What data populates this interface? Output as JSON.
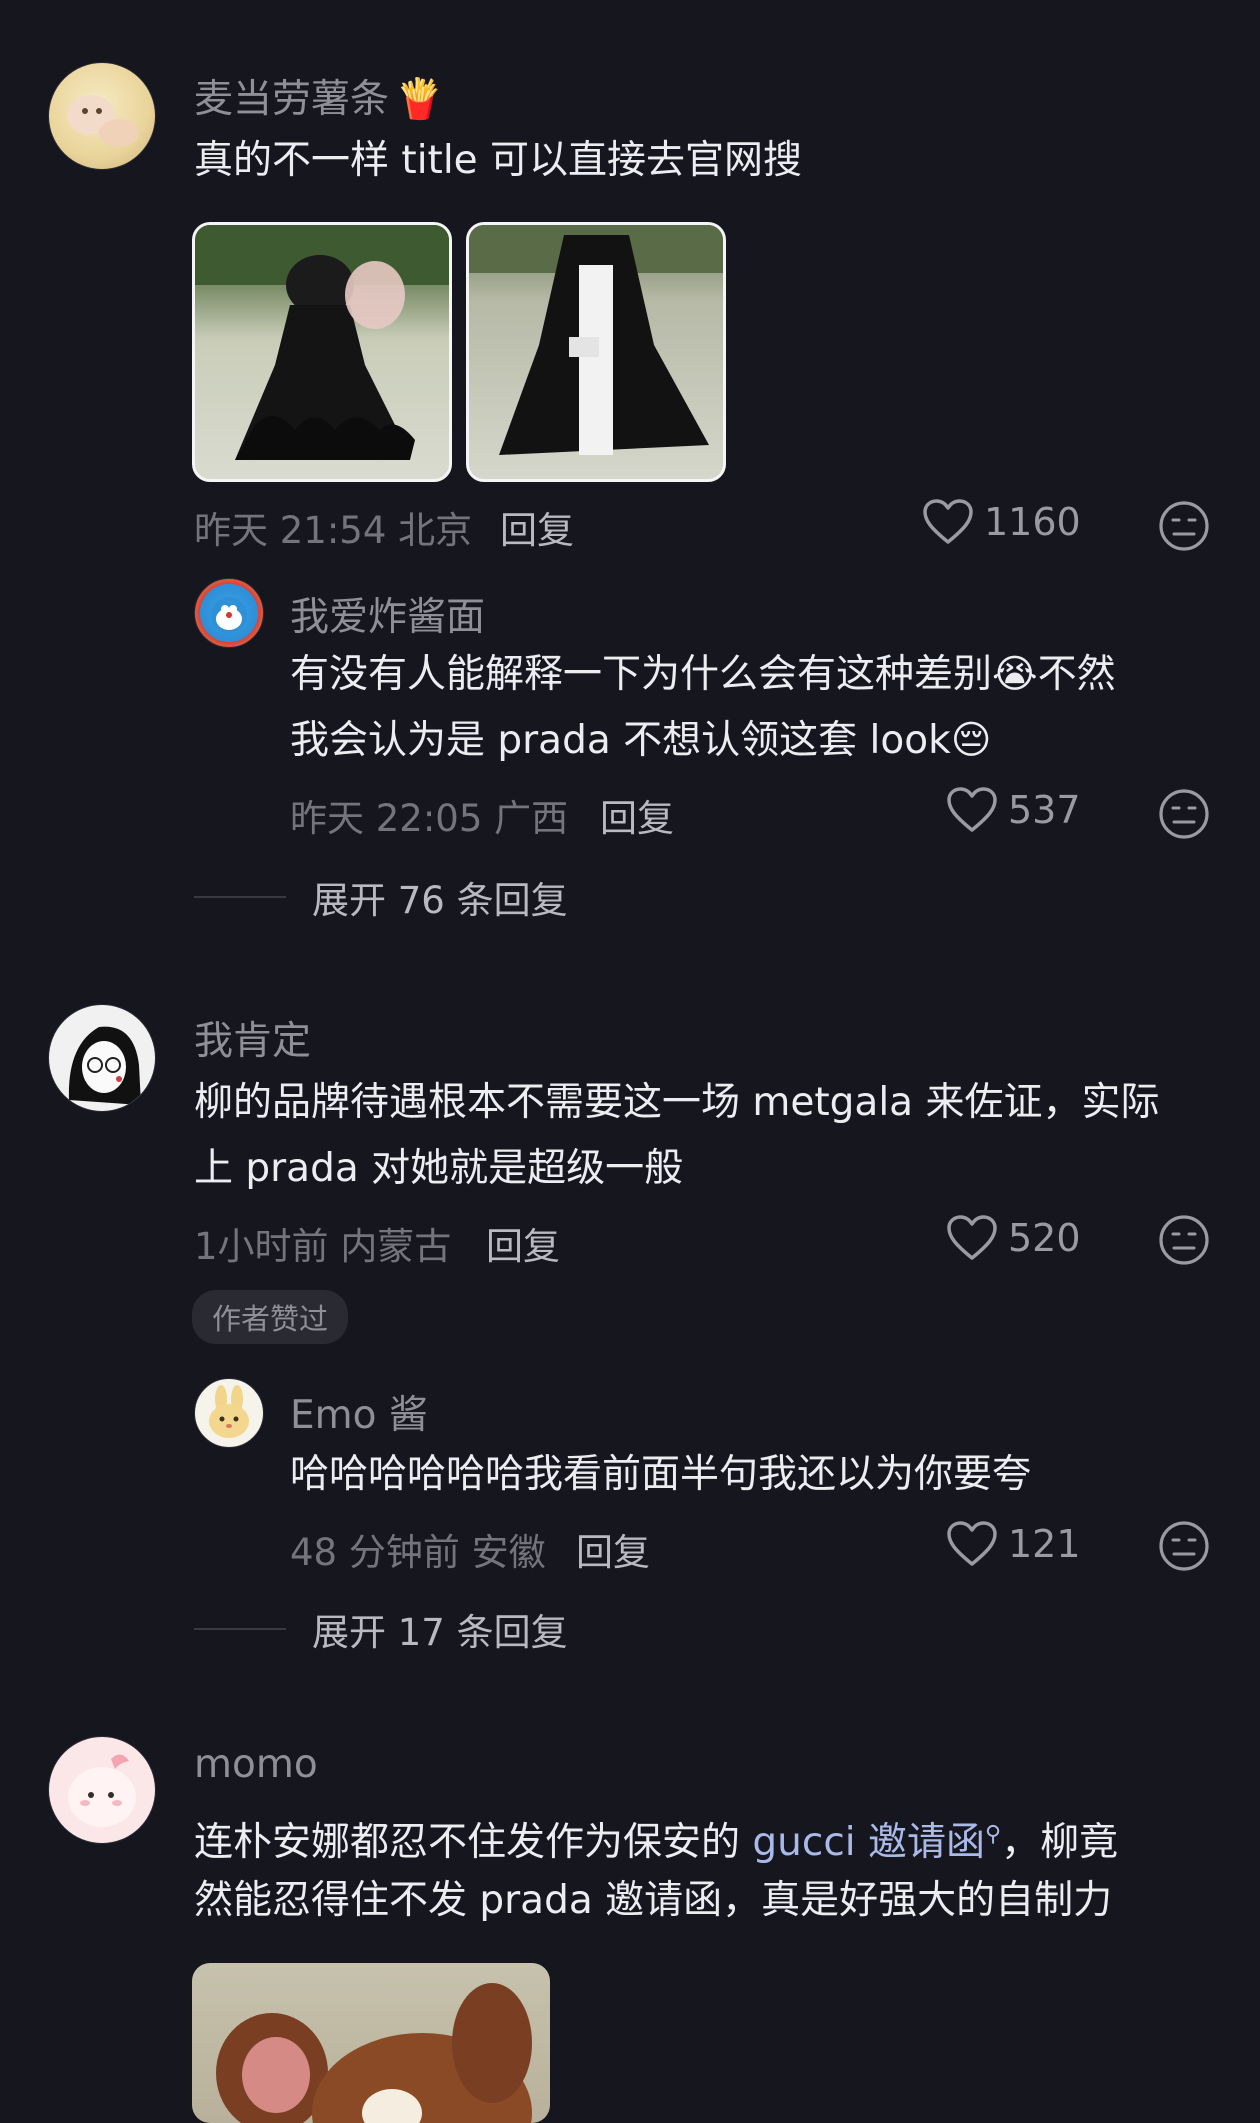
{
  "comments": [
    {
      "username": "麦当劳薯条",
      "username_emoji": "🍟",
      "text": "真的不一样 title 可以直接去官网搜",
      "time": "昨天 21:54",
      "location": "北京",
      "reply_label": "回复",
      "likes": "1160",
      "replies": [
        {
          "username": "我爱炸酱面",
          "text_line1": "有没有人能解释一下为什么会有这种差别",
          "emoji_cry": "😭",
          "text_line1_tail": "不然",
          "text_line2": "我会认为是 prada 不想认领这套 look",
          "emoji_sad": "😔",
          "time": "昨天 22:05",
          "location": "广西",
          "reply_label": "回复",
          "likes": "537"
        }
      ],
      "expand_label": "展开 76 条回复"
    },
    {
      "username": "我肯定",
      "text_line1": "柳的品牌待遇根本不需要这一场 metgala 来佐证，实际",
      "text_line2": "上 prada 对她就是超级一般",
      "time": "1小时前",
      "location": "内蒙古",
      "reply_label": "回复",
      "likes": "520",
      "badge": "作者赞过",
      "replies": [
        {
          "username": "Emo 酱",
          "text": "哈哈哈哈哈哈我看前面半句我还以为你要夸",
          "time": "48 分钟前",
          "location": "安徽",
          "reply_label": "回复",
          "likes": "121"
        }
      ],
      "expand_label": "展开 17 条回复"
    },
    {
      "username": "momo",
      "text_line1_pre": "连朴安娜都忍不住发作为保安的 ",
      "text_line1_link": "gucci 邀请函",
      "text_line1_post": "，柳竟",
      "text_line2": "然能忍得住不发 prada 邀请函，真是好强大的自制力"
    }
  ],
  "icons": {
    "like": "heart-outline-icon",
    "dislike": "meh-face-icon",
    "search_superscript": "search-icon"
  }
}
